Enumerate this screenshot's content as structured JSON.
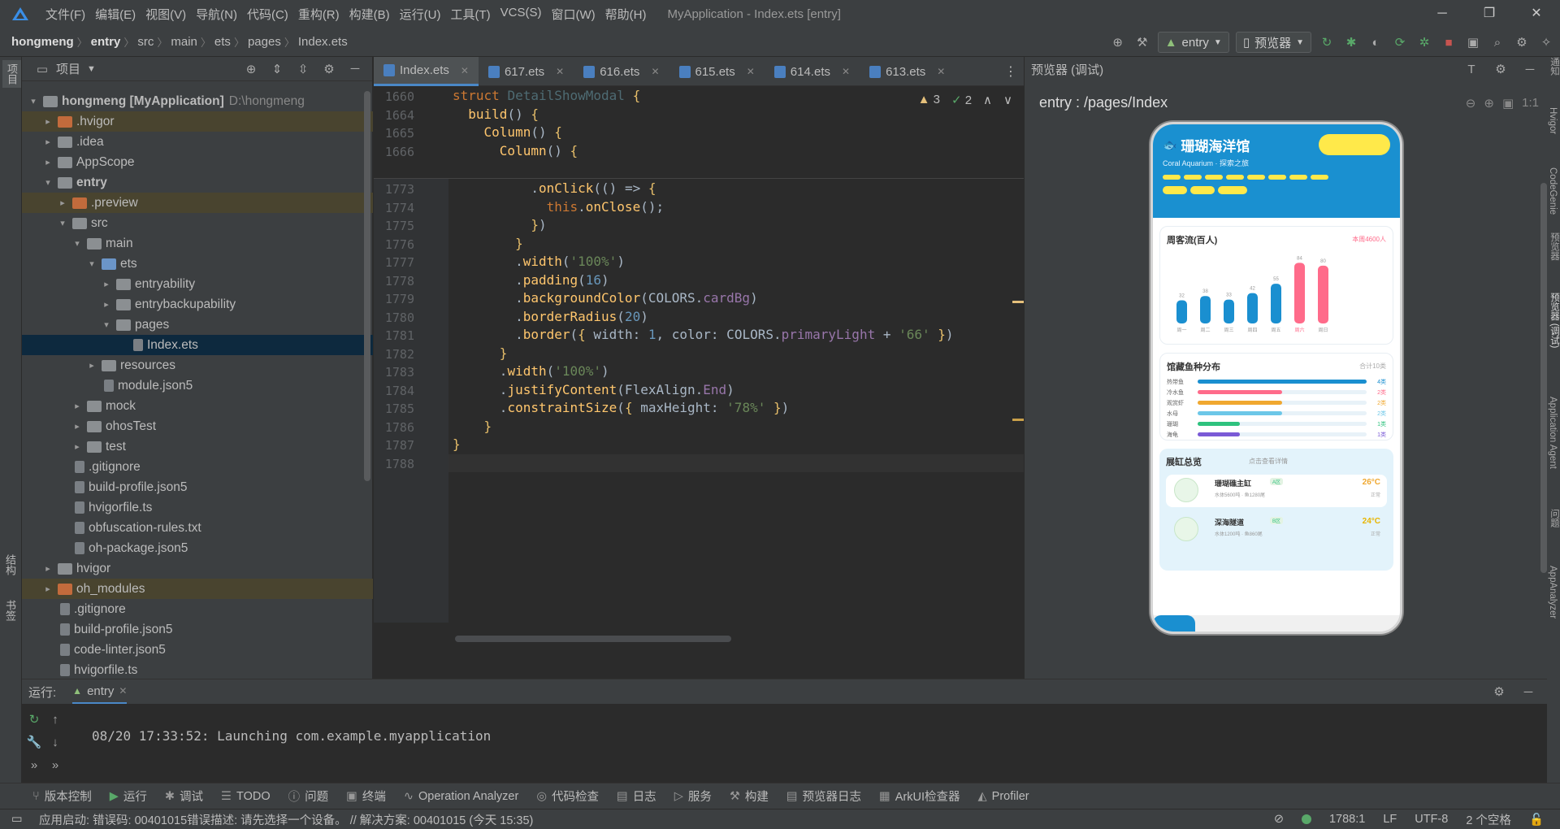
{
  "app": {
    "title": "MyApplication - Index.ets [entry]"
  },
  "menu": [
    "文件(F)",
    "编辑(E)",
    "视图(V)",
    "导航(N)",
    "代码(C)",
    "重构(R)",
    "构建(B)",
    "运行(U)",
    "工具(T)",
    "VCS(S)",
    "窗口(W)",
    "帮助(H)"
  ],
  "breadcrumb": [
    "hongmeng",
    "entry",
    "src",
    "main",
    "ets",
    "pages",
    "Index.ets"
  ],
  "toolbar": {
    "run_config": "entry",
    "device": "预览器"
  },
  "left_tabs": {
    "project": "项目",
    "structure": "结构",
    "bookmarks": "书签"
  },
  "project_panel": {
    "title": "项目",
    "tree": [
      {
        "label": "hongmeng [MyApplication]",
        "extra": "D:\\hongmeng",
        "depth": 0,
        "arrow": "▾",
        "icon": "fold"
      },
      {
        "label": ".hvigor",
        "depth": 1,
        "arrow": "▸",
        "icon": "fold o",
        "excluded": true
      },
      {
        "label": ".idea",
        "depth": 1,
        "arrow": "▸",
        "icon": "fold"
      },
      {
        "label": "AppScope",
        "depth": 1,
        "arrow": "▸",
        "icon": "fold"
      },
      {
        "label": "entry",
        "depth": 1,
        "arrow": "▾",
        "icon": "fold",
        "bold": true
      },
      {
        "label": ".preview",
        "depth": 2,
        "arrow": "▸",
        "icon": "fold o",
        "excluded": true
      },
      {
        "label": "src",
        "depth": 2,
        "arrow": "▾",
        "icon": "fold"
      },
      {
        "label": "main",
        "depth": 3,
        "arrow": "▾",
        "icon": "fold"
      },
      {
        "label": "ets",
        "depth": 4,
        "arrow": "▾",
        "icon": "fold b"
      },
      {
        "label": "entryability",
        "depth": 5,
        "arrow": "▸",
        "icon": "fold"
      },
      {
        "label": "entrybackupability",
        "depth": 5,
        "arrow": "▸",
        "icon": "fold"
      },
      {
        "label": "pages",
        "depth": 5,
        "arrow": "▾",
        "icon": "fold"
      },
      {
        "label": "Index.ets",
        "depth": 6,
        "arrow": "",
        "icon": "file",
        "selected": true
      },
      {
        "label": "resources",
        "depth": 4,
        "arrow": "▸",
        "icon": "fold"
      },
      {
        "label": "module.json5",
        "depth": 4,
        "arrow": "",
        "icon": "file"
      },
      {
        "label": "mock",
        "depth": 3,
        "arrow": "▸",
        "icon": "fold"
      },
      {
        "label": "ohosTest",
        "depth": 3,
        "arrow": "▸",
        "icon": "fold"
      },
      {
        "label": "test",
        "depth": 3,
        "arrow": "▸",
        "icon": "fold"
      },
      {
        "label": ".gitignore",
        "depth": 2,
        "arrow": "",
        "icon": "file"
      },
      {
        "label": "build-profile.json5",
        "depth": 2,
        "arrow": "",
        "icon": "file"
      },
      {
        "label": "hvigorfile.ts",
        "depth": 2,
        "arrow": "",
        "icon": "file"
      },
      {
        "label": "obfuscation-rules.txt",
        "depth": 2,
        "arrow": "",
        "icon": "file"
      },
      {
        "label": "oh-package.json5",
        "depth": 2,
        "arrow": "",
        "icon": "file"
      },
      {
        "label": "hvigor",
        "depth": 1,
        "arrow": "▸",
        "icon": "fold"
      },
      {
        "label": "oh_modules",
        "depth": 1,
        "arrow": "▸",
        "icon": "fold o",
        "excluded": true
      },
      {
        "label": ".gitignore",
        "depth": 1,
        "arrow": "",
        "icon": "file"
      },
      {
        "label": "build-profile.json5",
        "depth": 1,
        "arrow": "",
        "icon": "file"
      },
      {
        "label": "code-linter.json5",
        "depth": 1,
        "arrow": "",
        "icon": "file"
      },
      {
        "label": "hvigorfile.ts",
        "depth": 1,
        "arrow": "",
        "icon": "file"
      }
    ]
  },
  "editor_tabs": [
    "Index.ets",
    "617.ets",
    "616.ets",
    "615.ets",
    "614.ets",
    "613.ets"
  ],
  "inspections": {
    "warnings": "3",
    "ok": "2"
  },
  "sticky_lines": [
    {
      "n": "1660",
      "html": "<span class='kw'>struct</span> <span class='ty'>DetailShowModal</span> <span class='brk'>{</span>"
    },
    {
      "n": "1664",
      "html": "  <span class='fn'>build</span>() <span class='brk'>{</span>"
    },
    {
      "n": "1665",
      "html": "    <span class='fn'>Column</span>() <span class='brk'>{</span>"
    },
    {
      "n": "1666",
      "html": "      <span class='fn'>Column</span>() <span class='brk'>{</span>"
    }
  ],
  "code_lines": [
    {
      "n": "1773",
      "html": "          .<span class='fn'>onClick</span>(() => <span class='brk'>{</span>"
    },
    {
      "n": "1774",
      "html": "            <span class='kw'>this</span>.<span class='fn'>onClose</span>();"
    },
    {
      "n": "1775",
      "html": "          <span class='brk'>}</span>)"
    },
    {
      "n": "1776",
      "html": "        <span class='brk'>}</span>"
    },
    {
      "n": "1777",
      "html": "        .<span class='fn'>width</span>(<span class='str'>'100%'</span>)"
    },
    {
      "n": "1778",
      "html": "        .<span class='fn'>padding</span>(<span class='num'>16</span>)"
    },
    {
      "n": "1779",
      "html": "        .<span class='fn'>backgroundColor</span>(COLORS.<span class='prop'>cardBg</span>)"
    },
    {
      "n": "1780",
      "html": "        .<span class='fn'>borderRadius</span>(<span class='num'>20</span>)"
    },
    {
      "n": "1781",
      "html": "        .<span class='fn'>border</span>(<span class='brk'>{</span> width: <span class='num'>1</span>, color: COLORS.<span class='prop'>primaryLight</span> + <span class='str'>'66'</span> <span class='brk'>}</span>)"
    },
    {
      "n": "1782",
      "html": "      <span class='brk'>}</span>"
    },
    {
      "n": "1783",
      "html": "      .<span class='fn'>width</span>(<span class='str'>'100%'</span>)"
    },
    {
      "n": "1784",
      "html": "      .<span class='fn'>justifyContent</span>(FlexAlign.<span class='prop'>End</span>)"
    },
    {
      "n": "1785",
      "html": "      .<span class='fn'>constraintSize</span>(<span class='brk'>{</span> maxHeight: <span class='str'>'78%'</span> <span class='brk'>}</span>)"
    },
    {
      "n": "1786",
      "html": "    <span class='brk'>}</span>"
    },
    {
      "n": "1787",
      "html": "<span class='brk'>}</span>"
    },
    {
      "n": "1788",
      "html": ""
    }
  ],
  "preview": {
    "title": "预览器 (调试)",
    "path": "entry : /pages/Index",
    "app_title": "珊瑚海洋馆",
    "app_subtitle": "Coral Aquarium · 探索之旅",
    "visitors_title": "周客流(百人)",
    "visitors_note": "本周4600人",
    "days": [
      "周一",
      "周二",
      "周三",
      "周四",
      "周五",
      "周六",
      "周日"
    ],
    "visitors": [
      32,
      38,
      33,
      42,
      55,
      84,
      80
    ],
    "species_title": "馆藏鱼种分布",
    "species_note": "合计10类",
    "species": [
      {
        "name": "热带鱼",
        "value": "4类",
        "pct": 1.0,
        "color": "#1a8fd0"
      },
      {
        "name": "冷水鱼",
        "value": "2类",
        "pct": 0.5,
        "color": "#ff6b8a"
      },
      {
        "name": "观赏虾",
        "value": "2类",
        "pct": 0.5,
        "color": "#f0a830"
      },
      {
        "name": "水母",
        "value": "2类",
        "pct": 0.5,
        "color": "#6cc7e8"
      },
      {
        "name": "珊瑚",
        "value": "1类",
        "pct": 0.25,
        "color": "#2ec27e"
      },
      {
        "name": "海龟",
        "value": "1类",
        "pct": 0.25,
        "color": "#7a5ad6"
      }
    ],
    "tanks_title": "展缸总览",
    "tanks_note": "点击查看详情",
    "tanks": [
      {
        "name": "珊瑚礁主缸",
        "tag": "A区",
        "desc": "水体5600吨 · 鱼1280尾",
        "temp": "26°C",
        "status": "正常"
      },
      {
        "name": "深海隧道",
        "tag": "B区",
        "desc": "水体1200吨 · 鱼860尾",
        "temp": "24°C",
        "status": "正常"
      }
    ]
  },
  "right_tabs": [
    "通知",
    "Hvigor",
    "CodeGenie",
    "预览器",
    "预览器 (调试)",
    "Application Agent",
    "问题",
    "AppAnalyzer"
  ],
  "run_panel": {
    "label": "运行:",
    "tab": "entry",
    "output": "08/20 17:33:52: Launching com.example.myapplication"
  },
  "bottom_tools": [
    "版本控制",
    "运行",
    "调试",
    "TODO",
    "问题",
    "终端",
    "Operation Analyzer",
    "代码检查",
    "日志",
    "服务",
    "构建",
    "预览器日志",
    "ArkUI检查器",
    "Profiler"
  ],
  "status": {
    "message": "应用启动: 错误码: 00401015错误描述: 请先选择一个设备。 // 解决方案: 00401015 (今天 15:35)",
    "position": "1788:1",
    "line_sep": "LF",
    "encoding": "UTF-8",
    "indent": "2 个空格"
  },
  "colors": {
    "accent": "#4a88c7",
    "ok": "#59a869",
    "error": "#c75450"
  }
}
